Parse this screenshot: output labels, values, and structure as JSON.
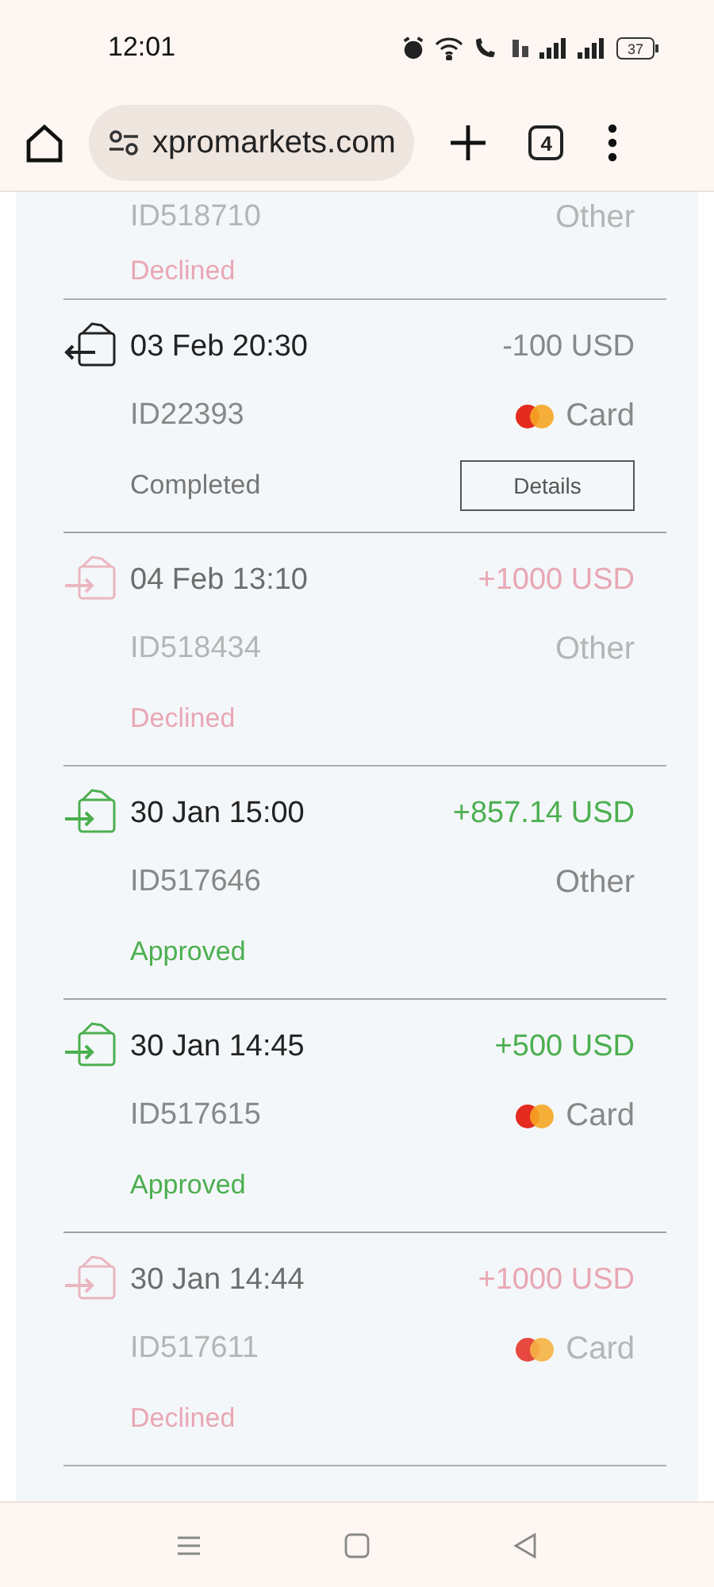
{
  "status_bar": {
    "time": "12:01",
    "battery": "37"
  },
  "browser": {
    "url": "xpromarkets.com",
    "tab_count": "4"
  },
  "transactions": [
    {
      "id": "ID518710",
      "card_logo": false,
      "method": "Other",
      "faded": true,
      "status": {
        "text": "Declined",
        "color": "#e79aa8"
      }
    },
    {
      "kind": "withdrawal",
      "date": "03 Feb 20:30",
      "amount": "-100 USD",
      "id": "ID22393",
      "card_logo": true,
      "method": "Card",
      "faded": false,
      "status": {
        "text": "Completed",
        "color": "#777777"
      },
      "button": "Details"
    },
    {
      "kind": "deposit",
      "date": "04 Feb 13:10",
      "amount": "+1000 USD",
      "id": "ID518434",
      "card_logo": false,
      "method": "Other",
      "faded": true,
      "status": {
        "text": "Declined",
        "color": "#e79aa8"
      }
    },
    {
      "kind": "deposit",
      "date": "30 Jan 15:00",
      "amount": "+857.14 USD",
      "id": "ID517646",
      "card_logo": false,
      "method": "Other",
      "faded": false,
      "status": {
        "text": "Approved",
        "color": "#4caf50"
      }
    },
    {
      "kind": "deposit",
      "date": "30 Jan 14:45",
      "amount": "+500 USD",
      "id": "ID517615",
      "card_logo": true,
      "method": "Card",
      "faded": false,
      "status": {
        "text": "Approved",
        "color": "#4caf50"
      }
    },
    {
      "kind": "deposit",
      "date": "30 Jan 14:44",
      "amount": "+1000 USD",
      "id": "ID517611",
      "card_logo": true,
      "method": "Card",
      "faded": true,
      "status": {
        "text": "Declined",
        "color": "#e79aa8"
      }
    }
  ]
}
